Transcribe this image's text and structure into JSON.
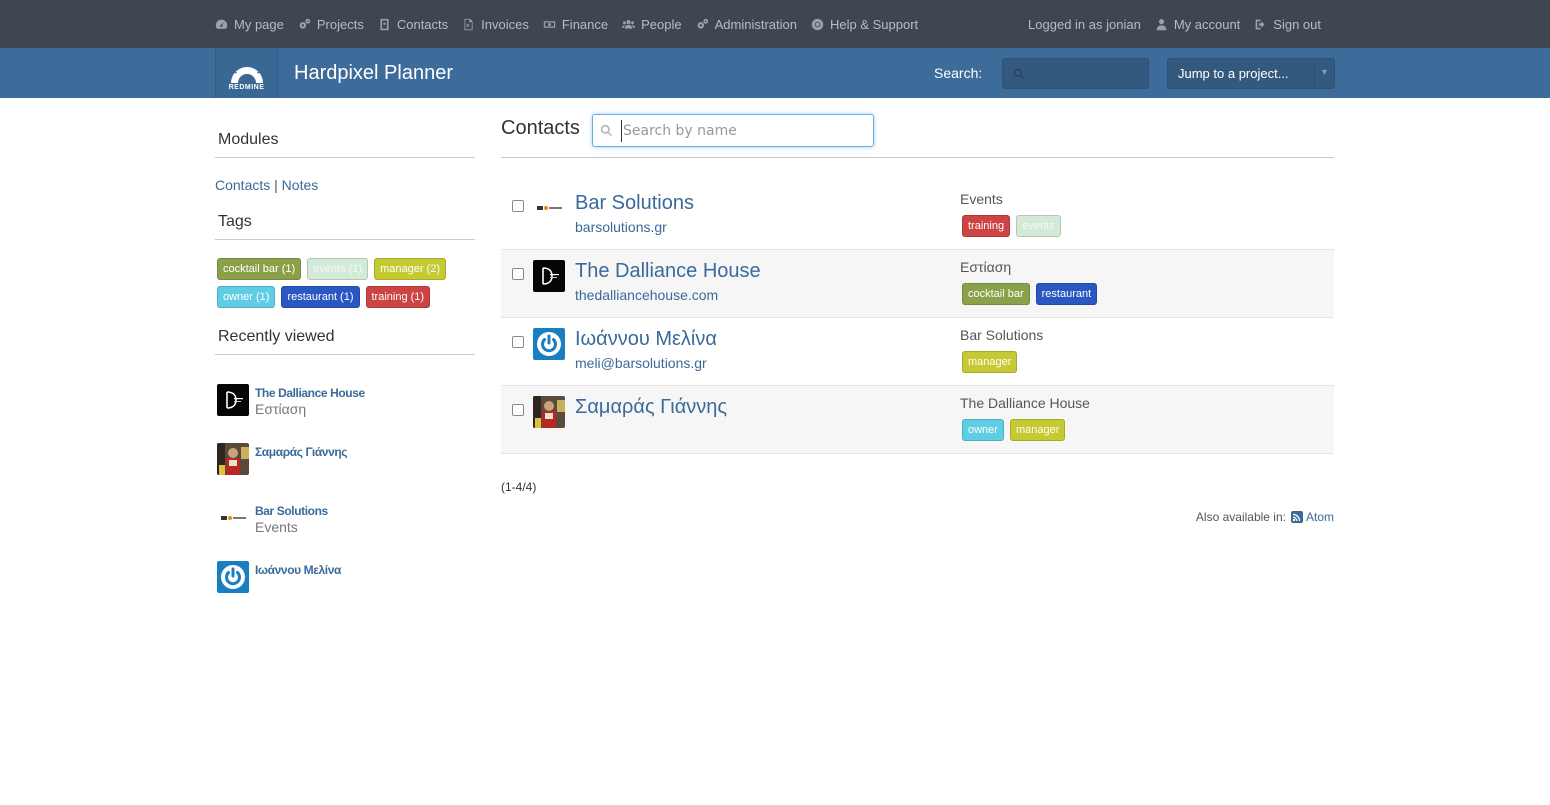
{
  "top_menu": {
    "items": [
      {
        "label": "My page",
        "icon": "dashboard-icon"
      },
      {
        "label": "Projects",
        "icon": "cogs-icon"
      },
      {
        "label": "Contacts",
        "icon": "address-card-icon"
      },
      {
        "label": "Invoices",
        "icon": "file-excel-icon"
      },
      {
        "label": "Finance",
        "icon": "money-icon"
      },
      {
        "label": "People",
        "icon": "users-icon"
      },
      {
        "label": "Administration",
        "icon": "cogs-icon"
      },
      {
        "label": "Help & Support",
        "icon": "life-ring-icon"
      }
    ],
    "logged_in": "Logged in as jonian",
    "my_account": "My account",
    "sign_out": "Sign out"
  },
  "header": {
    "logo_text": "REDMINE",
    "title": "Hardpixel Planner",
    "search_label": "Search:",
    "search_value": "",
    "jump_label": "Jump to a project...",
    "jump_caret": "▼"
  },
  "sidebar": {
    "modules_heading": "Modules",
    "modules_links": [
      "Contacts",
      "Notes"
    ],
    "modules_sep": "|",
    "tags_heading": "Tags",
    "tags": [
      {
        "label": "cocktail bar (1)",
        "color": "#8aa14a"
      },
      {
        "label": "events (1)",
        "color": "#d4ead8"
      },
      {
        "label": "manager (2)",
        "color": "#c5c932"
      },
      {
        "label": "owner (1)",
        "color": "#5fcde4"
      },
      {
        "label": "restaurant (1)",
        "color": "#2a57c2"
      },
      {
        "label": "training (1)",
        "color": "#cc4444"
      }
    ],
    "recent_heading": "Recently viewed",
    "recent": [
      {
        "name": "The Dalliance House",
        "sub": "Εστίαση",
        "avatar": "dalliance"
      },
      {
        "name": "Σαμαράς Γιάννης",
        "sub": "",
        "avatar": "photo"
      },
      {
        "name": "Bar Solutions",
        "sub": "Events",
        "avatar": "barsolutions"
      },
      {
        "name": "Ιωάννου Μελίνα",
        "sub": "",
        "avatar": "power"
      }
    ]
  },
  "main": {
    "title": "Contacts",
    "search_placeholder": "Search by name",
    "contacts": [
      {
        "name": "Bar Solutions",
        "link": "barsolutions.gr",
        "company": "Events",
        "avatar": "barsolutions",
        "tags": [
          {
            "label": "training",
            "color": "#cc4444"
          },
          {
            "label": "events",
            "color": "#d4ead8"
          }
        ]
      },
      {
        "name": "The Dalliance House",
        "link": "thedalliancehouse.com",
        "company": "Εστίαση",
        "avatar": "dalliance",
        "tags": [
          {
            "label": "cocktail bar",
            "color": "#8aa14a"
          },
          {
            "label": "restaurant",
            "color": "#2a57c2"
          }
        ]
      },
      {
        "name": "Ιωάννου Μελίνα",
        "link": "meli@barsolutions.gr",
        "company": "Bar Solutions",
        "avatar": "power",
        "tags": [
          {
            "label": "manager",
            "color": "#c5c932"
          }
        ]
      },
      {
        "name": "Σαμαράς Γιάννης",
        "link": "",
        "company": "The Dalliance House",
        "avatar": "photo",
        "tags": [
          {
            "label": "owner",
            "color": "#5fcde4"
          },
          {
            "label": "manager",
            "color": "#c5c932"
          }
        ]
      }
    ],
    "pagination": "(1-4/4)",
    "also_available": "Also available in:",
    "atom": "Atom"
  }
}
